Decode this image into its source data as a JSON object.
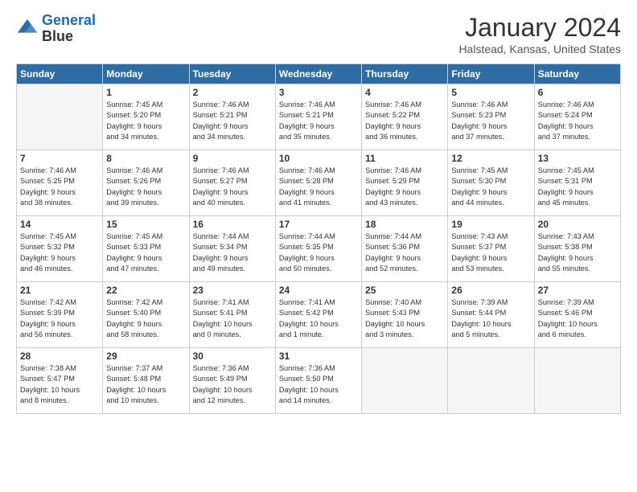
{
  "header": {
    "logo_line1": "General",
    "logo_line2": "Blue",
    "month": "January 2024",
    "location": "Halstead, Kansas, United States"
  },
  "days_of_week": [
    "Sunday",
    "Monday",
    "Tuesday",
    "Wednesday",
    "Thursday",
    "Friday",
    "Saturday"
  ],
  "weeks": [
    [
      {
        "day": "",
        "info": ""
      },
      {
        "day": "1",
        "info": "Sunrise: 7:45 AM\nSunset: 5:20 PM\nDaylight: 9 hours\nand 34 minutes."
      },
      {
        "day": "2",
        "info": "Sunrise: 7:46 AM\nSunset: 5:21 PM\nDaylight: 9 hours\nand 34 minutes."
      },
      {
        "day": "3",
        "info": "Sunrise: 7:46 AM\nSunset: 5:21 PM\nDaylight: 9 hours\nand 35 minutes."
      },
      {
        "day": "4",
        "info": "Sunrise: 7:46 AM\nSunset: 5:22 PM\nDaylight: 9 hours\nand 36 minutes."
      },
      {
        "day": "5",
        "info": "Sunrise: 7:46 AM\nSunset: 5:23 PM\nDaylight: 9 hours\nand 37 minutes."
      },
      {
        "day": "6",
        "info": "Sunrise: 7:46 AM\nSunset: 5:24 PM\nDaylight: 9 hours\nand 37 minutes."
      }
    ],
    [
      {
        "day": "7",
        "info": "Sunrise: 7:46 AM\nSunset: 5:25 PM\nDaylight: 9 hours\nand 38 minutes."
      },
      {
        "day": "8",
        "info": "Sunrise: 7:46 AM\nSunset: 5:26 PM\nDaylight: 9 hours\nand 39 minutes."
      },
      {
        "day": "9",
        "info": "Sunrise: 7:46 AM\nSunset: 5:27 PM\nDaylight: 9 hours\nand 40 minutes."
      },
      {
        "day": "10",
        "info": "Sunrise: 7:46 AM\nSunset: 5:28 PM\nDaylight: 9 hours\nand 41 minutes."
      },
      {
        "day": "11",
        "info": "Sunrise: 7:46 AM\nSunset: 5:29 PM\nDaylight: 9 hours\nand 43 minutes."
      },
      {
        "day": "12",
        "info": "Sunrise: 7:45 AM\nSunset: 5:30 PM\nDaylight: 9 hours\nand 44 minutes."
      },
      {
        "day": "13",
        "info": "Sunrise: 7:45 AM\nSunset: 5:31 PM\nDaylight: 9 hours\nand 45 minutes."
      }
    ],
    [
      {
        "day": "14",
        "info": "Sunrise: 7:45 AM\nSunset: 5:32 PM\nDaylight: 9 hours\nand 46 minutes."
      },
      {
        "day": "15",
        "info": "Sunrise: 7:45 AM\nSunset: 5:33 PM\nDaylight: 9 hours\nand 47 minutes."
      },
      {
        "day": "16",
        "info": "Sunrise: 7:44 AM\nSunset: 5:34 PM\nDaylight: 9 hours\nand 49 minutes."
      },
      {
        "day": "17",
        "info": "Sunrise: 7:44 AM\nSunset: 5:35 PM\nDaylight: 9 hours\nand 50 minutes."
      },
      {
        "day": "18",
        "info": "Sunrise: 7:44 AM\nSunset: 5:36 PM\nDaylight: 9 hours\nand 52 minutes."
      },
      {
        "day": "19",
        "info": "Sunrise: 7:43 AM\nSunset: 5:37 PM\nDaylight: 9 hours\nand 53 minutes."
      },
      {
        "day": "20",
        "info": "Sunrise: 7:43 AM\nSunset: 5:38 PM\nDaylight: 9 hours\nand 55 minutes."
      }
    ],
    [
      {
        "day": "21",
        "info": "Sunrise: 7:42 AM\nSunset: 5:39 PM\nDaylight: 9 hours\nand 56 minutes."
      },
      {
        "day": "22",
        "info": "Sunrise: 7:42 AM\nSunset: 5:40 PM\nDaylight: 9 hours\nand 58 minutes."
      },
      {
        "day": "23",
        "info": "Sunrise: 7:41 AM\nSunset: 5:41 PM\nDaylight: 10 hours\nand 0 minutes."
      },
      {
        "day": "24",
        "info": "Sunrise: 7:41 AM\nSunset: 5:42 PM\nDaylight: 10 hours\nand 1 minute."
      },
      {
        "day": "25",
        "info": "Sunrise: 7:40 AM\nSunset: 5:43 PM\nDaylight: 10 hours\nand 3 minutes."
      },
      {
        "day": "26",
        "info": "Sunrise: 7:39 AM\nSunset: 5:44 PM\nDaylight: 10 hours\nand 5 minutes."
      },
      {
        "day": "27",
        "info": "Sunrise: 7:39 AM\nSunset: 5:46 PM\nDaylight: 10 hours\nand 6 minutes."
      }
    ],
    [
      {
        "day": "28",
        "info": "Sunrise: 7:38 AM\nSunset: 5:47 PM\nDaylight: 10 hours\nand 8 minutes."
      },
      {
        "day": "29",
        "info": "Sunrise: 7:37 AM\nSunset: 5:48 PM\nDaylight: 10 hours\nand 10 minutes."
      },
      {
        "day": "30",
        "info": "Sunrise: 7:36 AM\nSunset: 5:49 PM\nDaylight: 10 hours\nand 12 minutes."
      },
      {
        "day": "31",
        "info": "Sunrise: 7:36 AM\nSunset: 5:50 PM\nDaylight: 10 hours\nand 14 minutes."
      },
      {
        "day": "",
        "info": ""
      },
      {
        "day": "",
        "info": ""
      },
      {
        "day": "",
        "info": ""
      }
    ]
  ]
}
